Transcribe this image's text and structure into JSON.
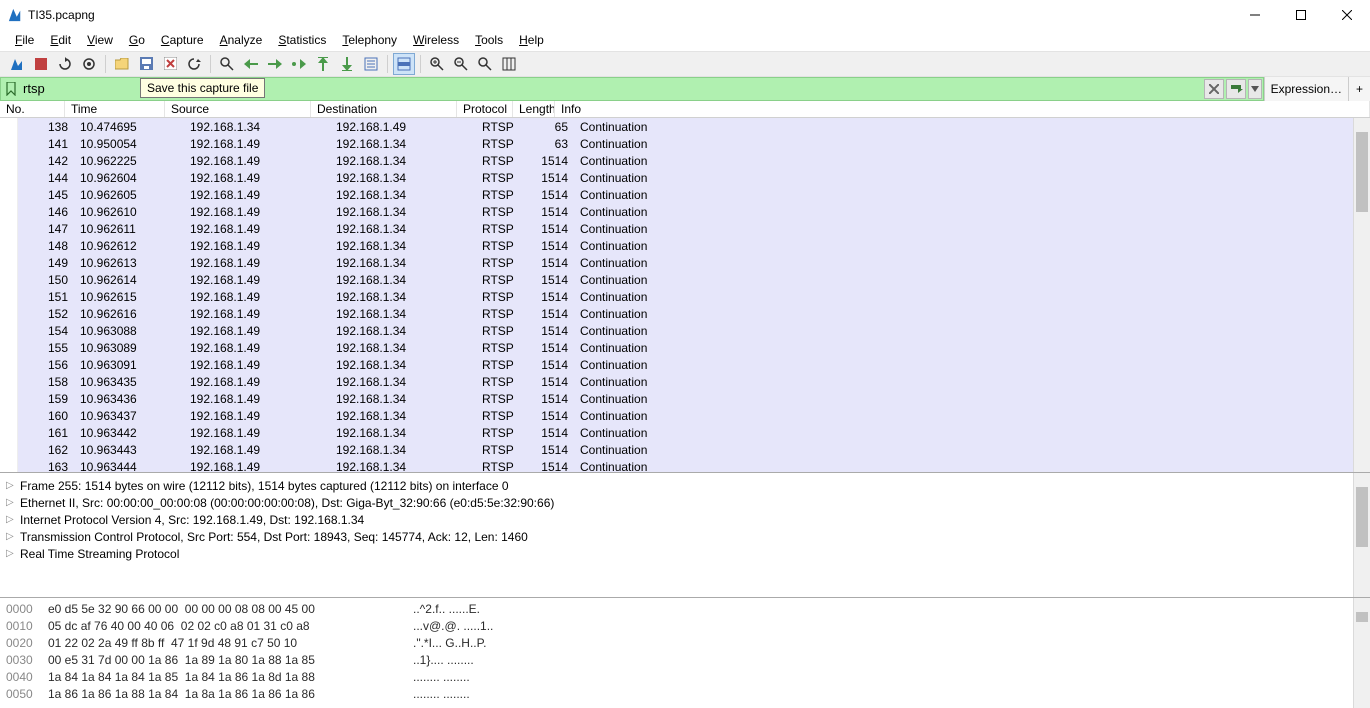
{
  "window": {
    "title": "TI35.pcapng"
  },
  "menu": [
    "File",
    "Edit",
    "View",
    "Go",
    "Capture",
    "Analyze",
    "Statistics",
    "Telephony",
    "Wireless",
    "Tools",
    "Help"
  ],
  "tooltip": "Save this capture file",
  "filter": {
    "value": "rtsp",
    "expression_label": "Expression…"
  },
  "columns": {
    "no": "No.",
    "time": "Time",
    "src": "Source",
    "dst": "Destination",
    "proto": "Protocol",
    "len": "Length",
    "info": "Info"
  },
  "packets": [
    {
      "no": "138",
      "time": "10.474695",
      "src": "192.168.1.34",
      "dst": "192.168.1.49",
      "proto": "RTSP",
      "len": "65",
      "info": "Continuation"
    },
    {
      "no": "141",
      "time": "10.950054",
      "src": "192.168.1.49",
      "dst": "192.168.1.34",
      "proto": "RTSP",
      "len": "63",
      "info": "Continuation"
    },
    {
      "no": "142",
      "time": "10.962225",
      "src": "192.168.1.49",
      "dst": "192.168.1.34",
      "proto": "RTSP",
      "len": "1514",
      "info": "Continuation"
    },
    {
      "no": "144",
      "time": "10.962604",
      "src": "192.168.1.49",
      "dst": "192.168.1.34",
      "proto": "RTSP",
      "len": "1514",
      "info": "Continuation"
    },
    {
      "no": "145",
      "time": "10.962605",
      "src": "192.168.1.49",
      "dst": "192.168.1.34",
      "proto": "RTSP",
      "len": "1514",
      "info": "Continuation"
    },
    {
      "no": "146",
      "time": "10.962610",
      "src": "192.168.1.49",
      "dst": "192.168.1.34",
      "proto": "RTSP",
      "len": "1514",
      "info": "Continuation"
    },
    {
      "no": "147",
      "time": "10.962611",
      "src": "192.168.1.49",
      "dst": "192.168.1.34",
      "proto": "RTSP",
      "len": "1514",
      "info": "Continuation"
    },
    {
      "no": "148",
      "time": "10.962612",
      "src": "192.168.1.49",
      "dst": "192.168.1.34",
      "proto": "RTSP",
      "len": "1514",
      "info": "Continuation"
    },
    {
      "no": "149",
      "time": "10.962613",
      "src": "192.168.1.49",
      "dst": "192.168.1.34",
      "proto": "RTSP",
      "len": "1514",
      "info": "Continuation"
    },
    {
      "no": "150",
      "time": "10.962614",
      "src": "192.168.1.49",
      "dst": "192.168.1.34",
      "proto": "RTSP",
      "len": "1514",
      "info": "Continuation"
    },
    {
      "no": "151",
      "time": "10.962615",
      "src": "192.168.1.49",
      "dst": "192.168.1.34",
      "proto": "RTSP",
      "len": "1514",
      "info": "Continuation"
    },
    {
      "no": "152",
      "time": "10.962616",
      "src": "192.168.1.49",
      "dst": "192.168.1.34",
      "proto": "RTSP",
      "len": "1514",
      "info": "Continuation"
    },
    {
      "no": "154",
      "time": "10.963088",
      "src": "192.168.1.49",
      "dst": "192.168.1.34",
      "proto": "RTSP",
      "len": "1514",
      "info": "Continuation"
    },
    {
      "no": "155",
      "time": "10.963089",
      "src": "192.168.1.49",
      "dst": "192.168.1.34",
      "proto": "RTSP",
      "len": "1514",
      "info": "Continuation"
    },
    {
      "no": "156",
      "time": "10.963091",
      "src": "192.168.1.49",
      "dst": "192.168.1.34",
      "proto": "RTSP",
      "len": "1514",
      "info": "Continuation"
    },
    {
      "no": "158",
      "time": "10.963435",
      "src": "192.168.1.49",
      "dst": "192.168.1.34",
      "proto": "RTSP",
      "len": "1514",
      "info": "Continuation"
    },
    {
      "no": "159",
      "time": "10.963436",
      "src": "192.168.1.49",
      "dst": "192.168.1.34",
      "proto": "RTSP",
      "len": "1514",
      "info": "Continuation"
    },
    {
      "no": "160",
      "time": "10.963437",
      "src": "192.168.1.49",
      "dst": "192.168.1.34",
      "proto": "RTSP",
      "len": "1514",
      "info": "Continuation"
    },
    {
      "no": "161",
      "time": "10.963442",
      "src": "192.168.1.49",
      "dst": "192.168.1.34",
      "proto": "RTSP",
      "len": "1514",
      "info": "Continuation"
    },
    {
      "no": "162",
      "time": "10.963443",
      "src": "192.168.1.49",
      "dst": "192.168.1.34",
      "proto": "RTSP",
      "len": "1514",
      "info": "Continuation"
    },
    {
      "no": "163",
      "time": "10.963444",
      "src": "192.168.1.49",
      "dst": "192.168.1.34",
      "proto": "RTSP",
      "len": "1514",
      "info": "Continuation"
    }
  ],
  "details": [
    "Frame 255: 1514 bytes on wire (12112 bits), 1514 bytes captured (12112 bits) on interface 0",
    "Ethernet II, Src: 00:00:00_00:00:08 (00:00:00:00:00:08), Dst: Giga-Byt_32:90:66 (e0:d5:5e:32:90:66)",
    "Internet Protocol Version 4, Src: 192.168.1.49, Dst: 192.168.1.34",
    "Transmission Control Protocol, Src Port: 554, Dst Port: 18943, Seq: 145774, Ack: 12, Len: 1460",
    "Real Time Streaming Protocol"
  ],
  "hex": [
    {
      "off": "0000",
      "b": "e0 d5 5e 32 90 66 00 00  00 00 00 08 08 00 45 00",
      "a": "..^2.f.. ......E."
    },
    {
      "off": "0010",
      "b": "05 dc af 76 40 00 40 06  02 02 c0 a8 01 31 c0 a8",
      "a": "...v@.@. .....1.."
    },
    {
      "off": "0020",
      "b": "01 22 02 2a 49 ff 8b ff  47 1f 9d 48 91 c7 50 10",
      "a": ".\".*I... G..H..P."
    },
    {
      "off": "0030",
      "b": "00 e5 31 7d 00 00 1a 86  1a 89 1a 80 1a 88 1a 85",
      "a": "..1}.... ........"
    },
    {
      "off": "0040",
      "b": "1a 84 1a 84 1a 84 1a 85  1a 84 1a 86 1a 8d 1a 88",
      "a": "........ ........"
    },
    {
      "off": "0050",
      "b": "1a 86 1a 86 1a 88 1a 84  1a 8a 1a 86 1a 86 1a 86",
      "a": "........ ........"
    }
  ]
}
